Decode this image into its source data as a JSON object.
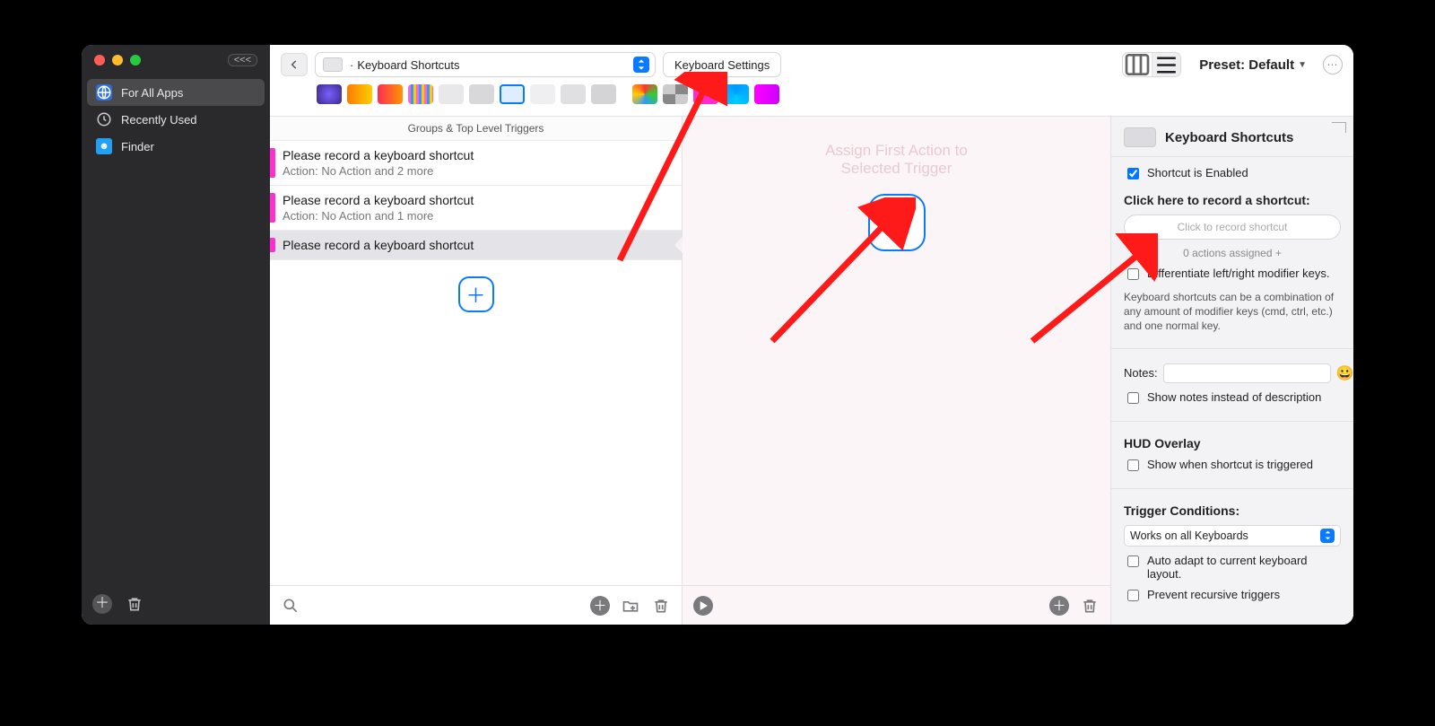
{
  "sidebar": {
    "pill": "<<<",
    "items": [
      {
        "label": "For All Apps"
      },
      {
        "label": "Recently Used"
      },
      {
        "label": "Finder"
      }
    ]
  },
  "toolbar": {
    "dropdown_label": "Keyboard Shortcuts",
    "settings_label": "Keyboard Settings",
    "preset_label": "Preset: Default"
  },
  "triggers": {
    "header": "Groups & Top Level Triggers",
    "rows": [
      {
        "title": "Please record a keyboard shortcut",
        "sub": "Action: No Action and 2 more"
      },
      {
        "title": "Please record a keyboard shortcut",
        "sub": "Action: No Action and 1 more"
      },
      {
        "title": "Please record a keyboard shortcut",
        "sub": ""
      }
    ]
  },
  "actions": {
    "placeholder_line1": "Assign First Action to",
    "placeholder_line2": "Selected Trigger"
  },
  "inspector": {
    "title": "Keyboard Shortcuts",
    "enabled_label": "Shortcut is Enabled",
    "record_heading": "Click here to record a shortcut:",
    "record_placeholder": "Click to record shortcut",
    "assigned": "0 actions assigned +",
    "diff_label": "Differentiate left/right modifier keys.",
    "help": "Keyboard shortcuts can be a combination of any amount of modifier keys (cmd, ctrl, etc.) and one normal key.",
    "notes_label": "Notes:",
    "notes_alt_label": "Show notes instead of description",
    "hud_title": "HUD Overlay",
    "hud_show_label": "Show when shortcut is triggered",
    "cond_title": "Trigger Conditions:",
    "cond_select": "Works on all Keyboards",
    "cond_auto": "Auto adapt to current keyboard layout.",
    "cond_recurse": "Prevent recursive triggers"
  }
}
